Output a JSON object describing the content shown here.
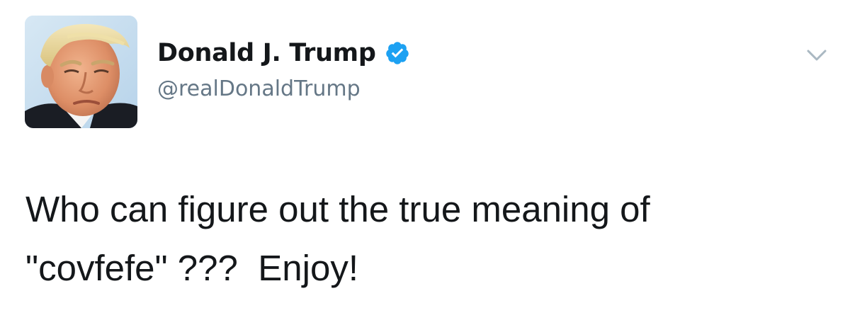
{
  "tweet": {
    "author": {
      "display_name": "Donald J. Trump",
      "handle": "@realDonaldTrump",
      "verified": true,
      "avatar": "profile-photo"
    },
    "text": "Who can figure out the true meaning of\n\"covfefe\" ???  Enjoy!",
    "icons": {
      "verified": "verified-badge-icon",
      "menu": "chevron-down-icon"
    },
    "colors": {
      "verified_badge": "#1da1f2",
      "handle": "#657786",
      "text": "#14171a",
      "chevron": "#aab8c2"
    }
  }
}
